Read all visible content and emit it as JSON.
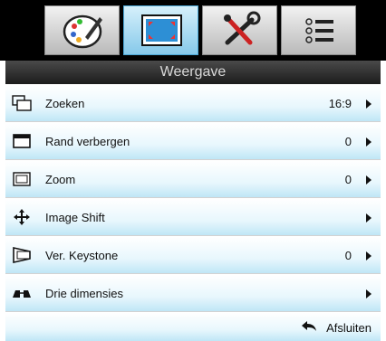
{
  "tabs": [
    {
      "name": "image-tab",
      "icon": "palette-icon"
    },
    {
      "name": "display-tab",
      "icon": "display-screen-icon",
      "active": true
    },
    {
      "name": "setup-tab",
      "icon": "tools-icon"
    },
    {
      "name": "options-tab",
      "icon": "list-icon"
    }
  ],
  "menu": {
    "title": "Weergave",
    "rows": [
      {
        "label": "Zoeken",
        "value": "16:9",
        "icon": "aspect-ratio-icon"
      },
      {
        "label": "Rand verbergen",
        "value": "0",
        "icon": "edge-mask-icon"
      },
      {
        "label": "Zoom",
        "value": "0",
        "icon": "zoom-icon"
      },
      {
        "label": "Image Shift",
        "value": "",
        "icon": "move-arrows-icon"
      },
      {
        "label": "Ver. Keystone",
        "value": "0",
        "icon": "keystone-icon"
      },
      {
        "label": "Drie dimensies",
        "value": "",
        "icon": "3d-glasses-icon"
      }
    ],
    "exit_label": "Afsluiten"
  }
}
